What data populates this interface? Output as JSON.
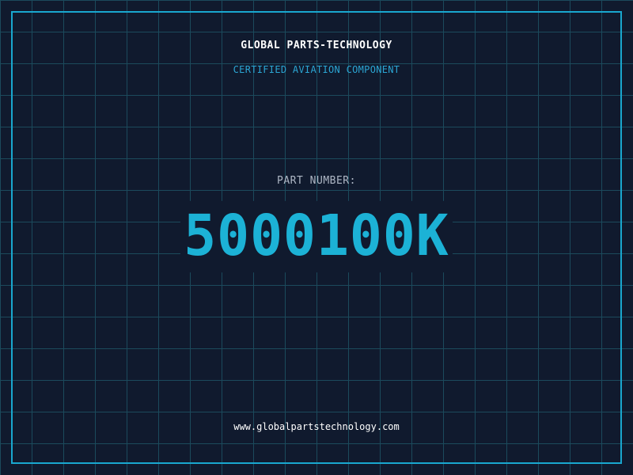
{
  "header": {
    "company": "GLOBAL PARTS-TECHNOLOGY",
    "subtitle": "CERTIFIED AVIATION COMPONENT"
  },
  "part": {
    "label": "PART NUMBER:",
    "number": "5000100K"
  },
  "footer": {
    "url": "www.globalpartstechnology.com"
  },
  "colors": {
    "background": "#101a2e",
    "grid": "#1b4a5c",
    "accent": "#1cb2d6",
    "frame": "#19a7cf"
  }
}
